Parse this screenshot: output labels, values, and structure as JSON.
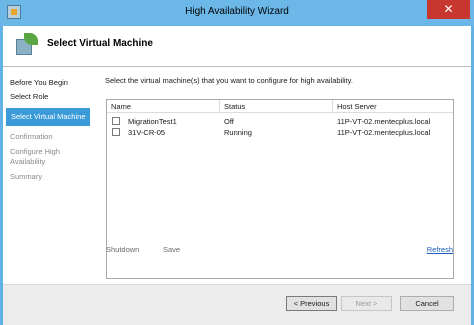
{
  "window": {
    "title": "High Availability Wizard",
    "close_glyph": "✕"
  },
  "header": {
    "title": "Select Virtual Machine"
  },
  "nav": {
    "items": [
      {
        "label": "Before You Begin",
        "state": "normal"
      },
      {
        "label": "Select Role",
        "state": "normal"
      },
      {
        "label": "Select Virtual Machine",
        "state": "selected"
      },
      {
        "label": "Confirmation",
        "state": "disabled"
      },
      {
        "label": "Configure High",
        "state": "disabled"
      },
      {
        "label": "Availability",
        "state": "disabled"
      },
      {
        "label": "Summary",
        "state": "disabled"
      }
    ]
  },
  "content": {
    "instruction": "Select the virtual machine(s) that you want to configure for high availability."
  },
  "vm_list": {
    "columns": [
      "Name",
      "Status",
      "Host Server"
    ],
    "rows": [
      {
        "name": "MigrationTest1",
        "status": "Off",
        "host": "11P-VT-02.mentecplus.local",
        "checked": false
      },
      {
        "name": "31V-CR-05",
        "status": "Running",
        "host": "11P-VT-02.mentecplus.local",
        "checked": false
      }
    ]
  },
  "actions": {
    "shutdown": "Shutdown",
    "save": "Save",
    "refresh": "Refresh"
  },
  "footer": {
    "previous": "< Previous",
    "next": "Next >",
    "cancel": "Cancel"
  },
  "colors": {
    "title_bar": "#6ab7e8",
    "selected_nav": "#3b9bd8",
    "close_button": "#c7372f",
    "link": "#1c5fb8"
  }
}
